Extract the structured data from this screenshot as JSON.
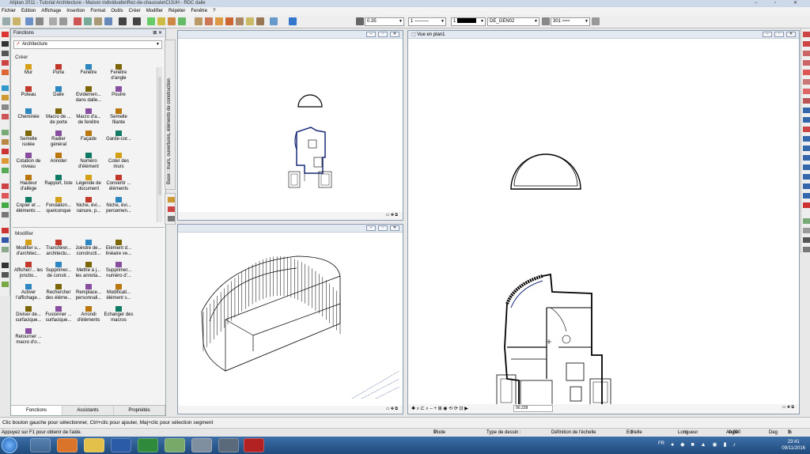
{
  "titlebar": {
    "title": "Allplan 2011 - Tutorial Architecture - Maison individuelle\\Rez-de-chaussée\\CIJUH - RDC dalle"
  },
  "menu": [
    "Fichier",
    "Edition",
    "Affichage",
    "Insertion",
    "Format",
    "Outils",
    "Créer",
    "Modifier",
    "Répéter",
    "Fenêtre",
    "?"
  ],
  "toolbar": {
    "pen": "0.35",
    "line": "1",
    "color": "1",
    "layer": "DE_GEN02",
    "hatch": "301"
  },
  "panel": {
    "title": "Fonctions",
    "module": "Architecture",
    "create_label": "Créer",
    "modify_label": "Modifier",
    "vertical_tab": "Base : murs, ouvertures, éléments de construction",
    "create_items": [
      [
        "Mur",
        "Porte",
        "Fenêtre",
        "Fenêtre d'angle"
      ],
      [
        "Poteau",
        "Dalle",
        "Evidemen... dans dalle...",
        "Poutre"
      ],
      [
        "Cheminée",
        "Macro de ... de porte",
        "Macro d'a... de fenêtre",
        "Semelle filante"
      ],
      [
        "Semelle isolée",
        "Radier général",
        "Façade",
        "Garde-cor..."
      ],
      [
        "Cotation de niveau",
        "Annoter",
        "Numéro d'élément",
        "Coter des murs"
      ],
      [
        "Hauteur d'allège",
        "Rapport, liste",
        "Légende de document",
        "Convertir ... éléments"
      ],
      [
        "Copier et ... éléments ...",
        "Fondation... quelconque",
        "Niche, évi... rainure, p...",
        "Niche, évi... percemen..."
      ]
    ],
    "modify_items": [
      [
        "Modifier u... d'architec...",
        "Transférer... architectu...",
        "Joindre de... constructi...",
        "Elément d... linéaire ve..."
      ],
      [
        "Afficher/... les jonctio...",
        "Supprimer... de constr...",
        "Mettre à j... les annota...",
        "Supprimer... numéro d'..."
      ],
      [
        "Activer l'affichage...",
        "Rechercher des éléme...",
        "Remplace... personnali...",
        "Modificati... élément s..."
      ],
      [
        "Diviser de... surfacique...",
        "Fusionner ... surfacique...",
        "Arrondi d'éléments",
        "Echanger des macros"
      ],
      [
        "Retourner ... macro d'o..."
      ]
    ],
    "tabs": [
      "Fonctions",
      "Assistants",
      "Propriétés"
    ]
  },
  "windows": {
    "plan_title": "Vue en plan1",
    "scale_value": "90.228"
  },
  "status": {
    "hint": "Clic bouton gauche pour sélectionner, Ctrl+clic pour ajouter, Maj+clic pour sélection segment"
  },
  "info": {
    "help": "Appuyez sur F1 pour obtenir de l'aide.",
    "mode_label": "Mode :",
    "mode_value": "7 Act",
    "drawing_type_label": "Type de dessin :",
    "scale_def": "Définition de l'échelle",
    "scale_label": "Echelle :",
    "scale_value": "1 : 100",
    "length_label": "Longueur :",
    "length_value": "m",
    "angle_label": "Angle :",
    "angle_value": "0.000",
    "deg_label": "Deg",
    "pct_label": "% :",
    "pct_value": "2"
  },
  "clock": {
    "time": "23:41",
    "date": "09/11/2016"
  },
  "taskbar": {
    "lang": "FR"
  }
}
